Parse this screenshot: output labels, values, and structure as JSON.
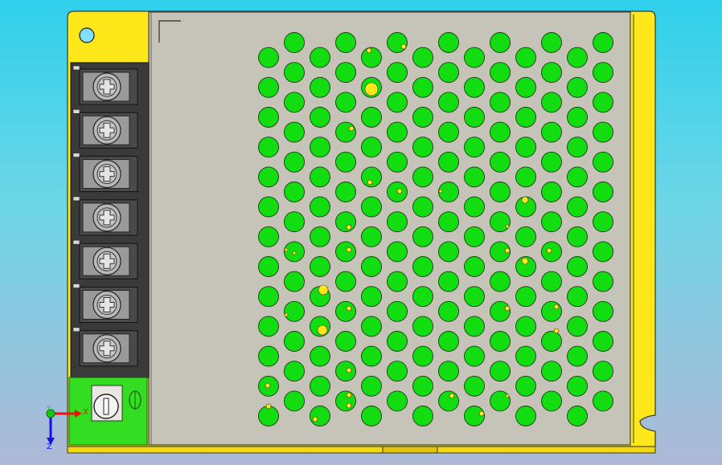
{
  "viewport": {
    "background_top": "#2fd0ec",
    "background_bottom": "#aeb8d6"
  },
  "model": {
    "type": "power-supply-unit",
    "view": "top",
    "frame_color": "#ffe81a",
    "cover_color": "#c6c4b8",
    "vent_hole_color": "#11dd11",
    "pcb_color": "#33dd22",
    "terminal_count": 7,
    "vent_grid": {
      "columns": 14,
      "rows": 26
    }
  },
  "triad": {
    "x_label": "X",
    "y_label": "Y",
    "z_label": "Z",
    "x_color": "#ee1111",
    "y_color": "#11cc11",
    "z_color": "#1111ee"
  }
}
